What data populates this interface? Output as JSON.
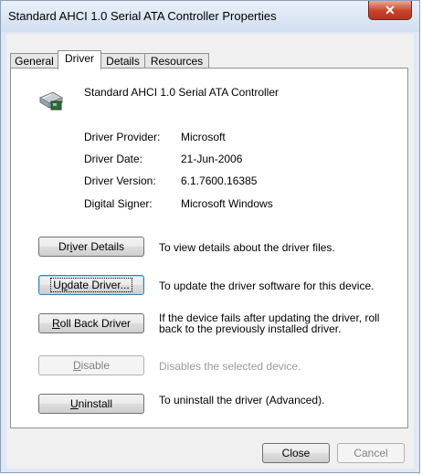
{
  "window": {
    "title": "Standard AHCI 1.0 Serial ATA Controller Properties",
    "close_glyph": "✕"
  },
  "tabs": [
    {
      "label": "General",
      "active": false
    },
    {
      "label": "Driver",
      "active": true
    },
    {
      "label": "Details",
      "active": false
    },
    {
      "label": "Resources",
      "active": false
    }
  ],
  "device": {
    "name": "Standard AHCI 1.0 Serial ATA Controller",
    "icon": "controller-card-icon"
  },
  "info": [
    {
      "label": "Driver Provider:",
      "value": "Microsoft"
    },
    {
      "label": "Driver Date:",
      "value": "21-Jun-2006"
    },
    {
      "label": "Driver Version:",
      "value": "6.1.7600.16385"
    },
    {
      "label": "Digital Signer:",
      "value": "Microsoft Windows"
    }
  ],
  "actions": {
    "details": {
      "pre": "Dr",
      "key": "i",
      "post": "ver Details",
      "desc": "To view details about the driver files."
    },
    "update": {
      "pre": "U",
      "key": "p",
      "post": "date Driver...",
      "desc": "To update the driver software for this device."
    },
    "rollback": {
      "pre": "",
      "key": "R",
      "post": "oll Back Driver",
      "desc_line1": "If the device fails after updating the driver, roll",
      "desc_line2": "back to the previously installed driver."
    },
    "disable": {
      "pre": "",
      "key": "D",
      "post": "isable",
      "desc": "Disables the selected device."
    },
    "uninstall": {
      "pre": "",
      "key": "U",
      "post": "ninstall",
      "desc": "To uninstall the driver (Advanced)."
    }
  },
  "footer": {
    "close_label": "Close",
    "cancel_label": "Cancel"
  }
}
